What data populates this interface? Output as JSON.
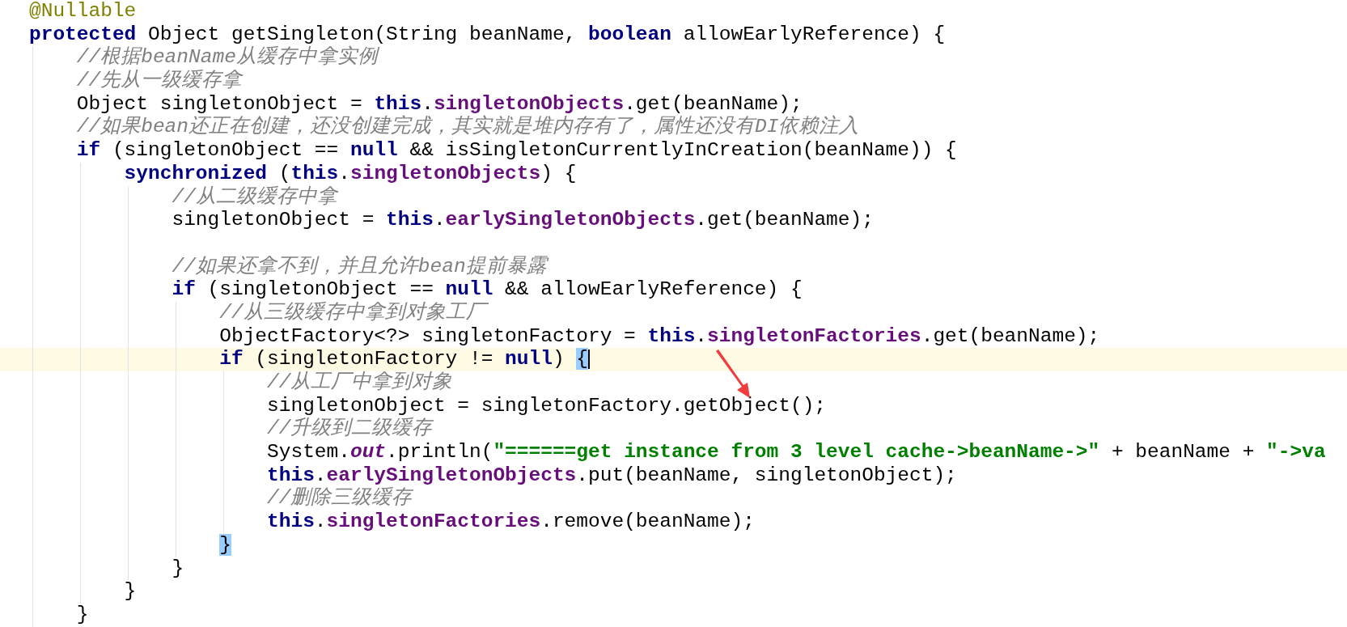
{
  "editor": {
    "lines": [
      {
        "current": false,
        "tokens": [
          {
            "kind": "annotation",
            "text": "@Nullable"
          }
        ]
      },
      {
        "current": false,
        "tokens": [
          {
            "kind": "keyword",
            "text": "protected"
          },
          {
            "kind": "plain",
            "text": " Object getSingleton(String beanName, "
          },
          {
            "kind": "keyword",
            "text": "boolean"
          },
          {
            "kind": "plain",
            "text": " allowEarlyReference) {"
          }
        ]
      },
      {
        "current": false,
        "tokens": [
          {
            "kind": "comment",
            "text": "    //根据beanName从缓存中拿实例"
          }
        ]
      },
      {
        "current": false,
        "tokens": [
          {
            "kind": "comment",
            "text": "    //先从一级缓存拿"
          }
        ]
      },
      {
        "current": false,
        "tokens": [
          {
            "kind": "plain",
            "text": "    Object singletonObject = "
          },
          {
            "kind": "keyword",
            "text": "this"
          },
          {
            "kind": "plain",
            "text": "."
          },
          {
            "kind": "field",
            "text": "singletonObjects"
          },
          {
            "kind": "plain",
            "text": ".get(beanName);"
          }
        ]
      },
      {
        "current": false,
        "tokens": [
          {
            "kind": "comment",
            "text": "    //如果bean还正在创建，还没创建完成，其实就是堆内存有了，属性还没有DI依赖注入"
          }
        ]
      },
      {
        "current": false,
        "tokens": [
          {
            "kind": "keyword",
            "text": "    if"
          },
          {
            "kind": "plain",
            "text": " (singletonObject == "
          },
          {
            "kind": "keyword",
            "text": "null"
          },
          {
            "kind": "plain",
            "text": " && isSingletonCurrentlyInCreation(beanName)) {"
          }
        ]
      },
      {
        "current": false,
        "tokens": [
          {
            "kind": "keyword",
            "text": "        synchronized"
          },
          {
            "kind": "plain",
            "text": " ("
          },
          {
            "kind": "keyword",
            "text": "this"
          },
          {
            "kind": "plain",
            "text": "."
          },
          {
            "kind": "field",
            "text": "singletonObjects"
          },
          {
            "kind": "plain",
            "text": ") {"
          }
        ]
      },
      {
        "current": false,
        "tokens": [
          {
            "kind": "comment",
            "text": "            //从二级缓存中拿"
          }
        ]
      },
      {
        "current": false,
        "tokens": [
          {
            "kind": "plain",
            "text": "            singletonObject = "
          },
          {
            "kind": "keyword",
            "text": "this"
          },
          {
            "kind": "plain",
            "text": "."
          },
          {
            "kind": "field",
            "text": "earlySingletonObjects"
          },
          {
            "kind": "plain",
            "text": ".get(beanName);"
          }
        ]
      },
      {
        "current": false
      },
      {
        "current": false,
        "tokens": [
          {
            "kind": "comment",
            "text": "            //如果还拿不到，并且允许bean提前暴露"
          }
        ]
      },
      {
        "current": false,
        "tokens": [
          {
            "kind": "keyword",
            "text": "            if"
          },
          {
            "kind": "plain",
            "text": " (singletonObject == "
          },
          {
            "kind": "keyword",
            "text": "null"
          },
          {
            "kind": "plain",
            "text": " && allowEarlyReference) {"
          }
        ]
      },
      {
        "current": false,
        "tokens": [
          {
            "kind": "comment",
            "text": "                //从三级缓存中拿到对象工厂"
          }
        ]
      },
      {
        "current": false,
        "tokens": [
          {
            "kind": "plain",
            "text": "                ObjectFactory<?> singletonFactory = "
          },
          {
            "kind": "keyword",
            "text": "this"
          },
          {
            "kind": "plain",
            "text": "."
          },
          {
            "kind": "field",
            "text": "singletonFactories"
          },
          {
            "kind": "plain",
            "text": ".get(beanName);"
          }
        ]
      },
      {
        "current": true,
        "tokens": [
          {
            "kind": "keyword",
            "text": "                if"
          },
          {
            "kind": "plain",
            "text": " (singletonFactory != "
          },
          {
            "kind": "keyword",
            "text": "null"
          },
          {
            "kind": "plain",
            "text": ") "
          },
          {
            "kind": "brace-match",
            "text": "{"
          }
        ]
      },
      {
        "current": false,
        "tokens": [
          {
            "kind": "comment",
            "text": "                    //从工厂中拿到对象"
          }
        ]
      },
      {
        "current": false,
        "tokens": [
          {
            "kind": "plain",
            "text": "                    singletonObject = singletonFactory.getObject();"
          }
        ]
      },
      {
        "current": false,
        "tokens": [
          {
            "kind": "comment",
            "text": "                    //升级到二级缓存"
          }
        ]
      },
      {
        "current": false,
        "tokens": [
          {
            "kind": "plain",
            "text": "                    System."
          },
          {
            "kind": "static",
            "text": "out"
          },
          {
            "kind": "plain",
            "text": ".println("
          },
          {
            "kind": "string",
            "text": "\"======get instance from 3 level cache->beanName->\""
          },
          {
            "kind": "plain",
            "text": " + beanName + "
          },
          {
            "kind": "string",
            "text": "\"->va"
          }
        ]
      },
      {
        "current": false,
        "tokens": [
          {
            "kind": "keyword",
            "text": "                    this"
          },
          {
            "kind": "plain",
            "text": "."
          },
          {
            "kind": "field",
            "text": "earlySingletonObjects"
          },
          {
            "kind": "plain",
            "text": ".put(beanName, singletonObject);"
          }
        ]
      },
      {
        "current": false,
        "tokens": [
          {
            "kind": "comment",
            "text": "                    //删除三级缓存"
          }
        ]
      },
      {
        "current": false,
        "tokens": [
          {
            "kind": "keyword",
            "text": "                    this"
          },
          {
            "kind": "plain",
            "text": "."
          },
          {
            "kind": "field",
            "text": "singletonFactories"
          },
          {
            "kind": "plain",
            "text": ".remove(beanName);"
          }
        ]
      },
      {
        "current": false,
        "tokens": [
          {
            "kind": "brace-match",
            "text": "                }"
          }
        ]
      },
      {
        "current": false,
        "tokens": [
          {
            "kind": "plain",
            "text": "            }"
          }
        ]
      },
      {
        "current": false,
        "tokens": [
          {
            "kind": "plain",
            "text": "        }"
          }
        ]
      },
      {
        "current": false,
        "tokens": [
          {
            "kind": "plain",
            "text": "    }"
          }
        ]
      }
    ]
  }
}
